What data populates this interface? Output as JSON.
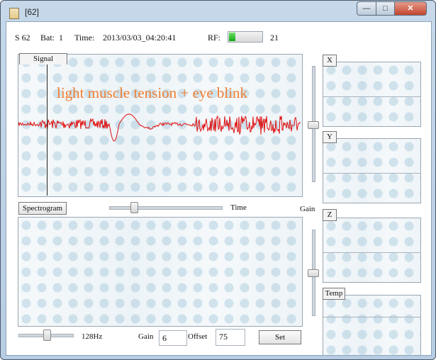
{
  "window": {
    "title": "[62]",
    "minimize_glyph": "—",
    "maximize_glyph": "□",
    "close_glyph": "✕"
  },
  "status": {
    "sensor": "S 62",
    "bat_label": "Bat:",
    "bat_value": "1",
    "time_label": "Time:",
    "time_value": "2013/03/03_04:20:41",
    "rf_label": "RF:",
    "rf_value": "21",
    "rf_level": 0.2
  },
  "signal": {
    "tab_label": "Signal",
    "annotation": "light muscle tension + eye blink",
    "trace_color": "#e01010"
  },
  "time_slider": {
    "label": "Time",
    "level": 0.2
  },
  "gain_slider": {
    "label": "Gain"
  },
  "spectrogram": {
    "button_label": "Spectrogram"
  },
  "freq_slider": {
    "label": "128Hz",
    "level": 0.5
  },
  "controls": {
    "gain_label": "Gain",
    "gain_value": "6",
    "offset_label": "Offset",
    "offset_value": "75",
    "set_label": "Set"
  },
  "axes": {
    "x_label": "X",
    "y_label": "Y",
    "z_label": "Z",
    "temp_label": "Temp"
  }
}
